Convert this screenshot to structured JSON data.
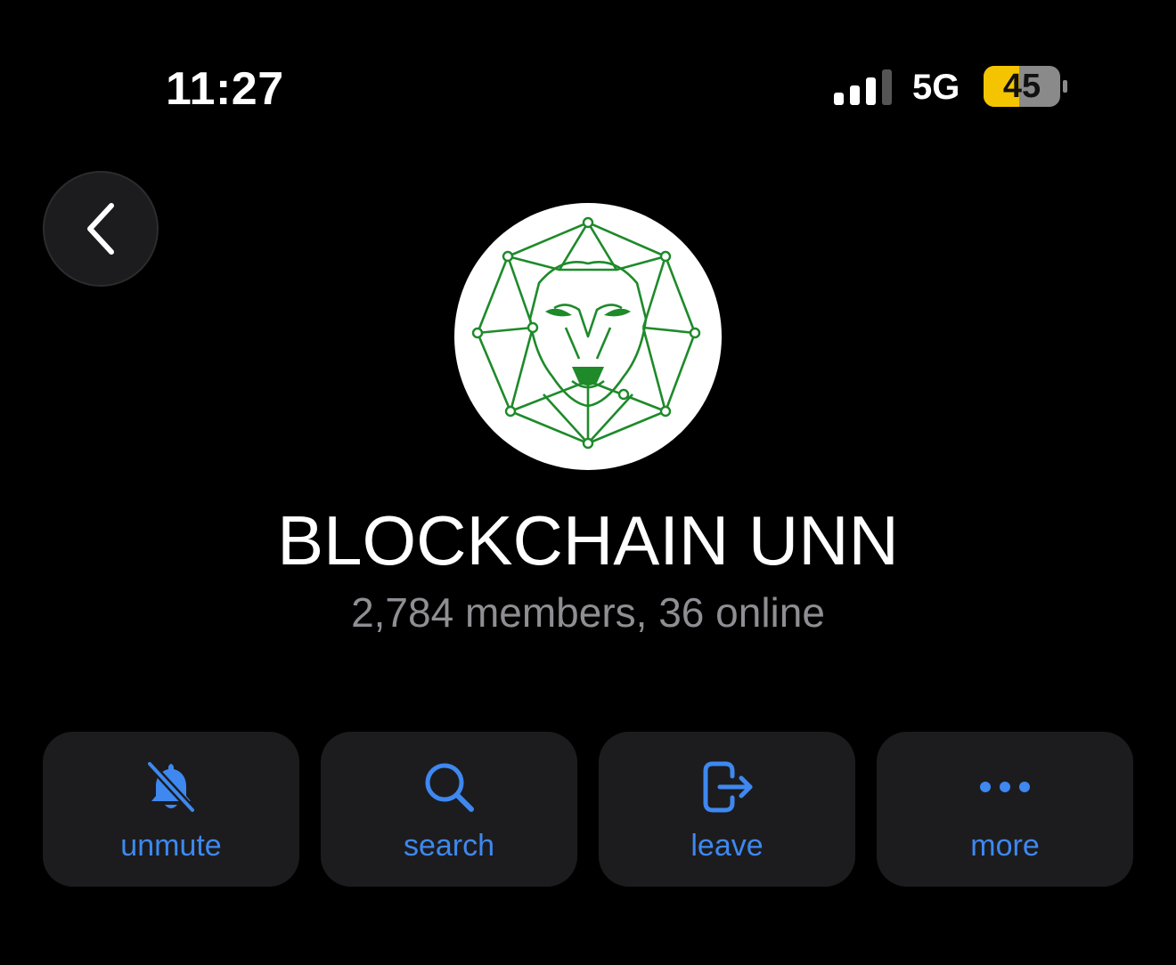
{
  "status_bar": {
    "time": "11:27",
    "network": "5G",
    "battery_level": "45",
    "icons": [
      "signal-icon",
      "battery-icon"
    ]
  },
  "header": {
    "back_icon": "chevron-left-icon"
  },
  "group": {
    "name": "BLOCKCHAIN UNN",
    "subtitle": "2,784 members, 36 online",
    "avatar": "lion-geometric-logo"
  },
  "actions": [
    {
      "label": "unmute",
      "icon": "bell-slash-icon"
    },
    {
      "label": "search",
      "icon": "search-icon"
    },
    {
      "label": "leave",
      "icon": "leave-icon"
    },
    {
      "label": "more",
      "icon": "more-dots-icon"
    }
  ],
  "colors": {
    "background": "#000000",
    "button_bg": "#1c1c1e",
    "accent": "#3e88f0",
    "subtitle": "#8e8e93",
    "battery": "#f4c400",
    "logo_green": "#1e8a2a"
  }
}
